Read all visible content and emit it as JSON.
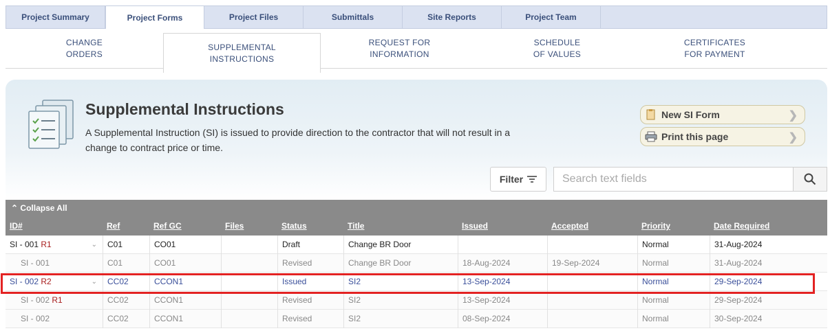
{
  "top_tabs": [
    "Project Summary",
    "Project Forms",
    "Project Files",
    "Submittals",
    "Site Reports",
    "Project Team"
  ],
  "sub_tabs": [
    "CHANGE\nORDERS",
    "SUPPLEMENTAL\nINSTRUCTIONS",
    "REQUEST FOR\nINFORMATION",
    "SCHEDULE\nOF VALUES",
    "CERTIFICATES\nFOR PAYMENT"
  ],
  "header": {
    "title": "Supplemental Instructions",
    "description": "A Supplemental Instruction (SI) is issued to provide direction to the contractor that will not result in a change to contract price or time.",
    "new_form_label": "New SI Form",
    "print_label": "Print this page"
  },
  "toolbar": {
    "filter_label": "Filter",
    "search_placeholder": "Search text fields"
  },
  "grid": {
    "collapse_label": "Collapse All",
    "columns": [
      "ID#",
      "Ref",
      "Ref GC",
      "Files",
      "Status",
      "Title",
      "Issued",
      "Accepted",
      "Priority",
      "Date Required"
    ],
    "rows": [
      {
        "id": "SI - 001",
        "rev": "R1",
        "ref": "C01",
        "ref_gc": "CO01",
        "files": "",
        "status": "Draft",
        "title": "Change BR Door",
        "issued": "",
        "accepted": "",
        "priority": "Normal",
        "date_required": "31-Aug-2024"
      },
      {
        "id": "SI - 001",
        "rev": "",
        "ref": "C01",
        "ref_gc": "CO01",
        "files": "",
        "status": "Revised",
        "title": "Change BR Door",
        "issued": "18-Aug-2024",
        "accepted": "19-Sep-2024",
        "priority": "Normal",
        "date_required": "31-Aug-2024"
      },
      {
        "id": "SI - 002",
        "rev": "R2",
        "ref": "CC02",
        "ref_gc": "CCON1",
        "files": "",
        "status": "Issued",
        "title": "SI2",
        "issued": "13-Sep-2024",
        "accepted": "",
        "priority": "Normal",
        "date_required": "29-Sep-2024"
      },
      {
        "id": "SI - 002",
        "rev": "R1",
        "ref": "CC02",
        "ref_gc": "CCON1",
        "files": "",
        "status": "Revised",
        "title": "SI2",
        "issued": "13-Sep-2024",
        "accepted": "",
        "priority": "Normal",
        "date_required": "29-Sep-2024"
      },
      {
        "id": "SI - 002",
        "rev": "",
        "ref": "CC02",
        "ref_gc": "CCON1",
        "files": "",
        "status": "Revised",
        "title": "SI2",
        "issued": "08-Sep-2024",
        "accepted": "",
        "priority": "Normal",
        "date_required": "30-Sep-2024"
      }
    ]
  }
}
